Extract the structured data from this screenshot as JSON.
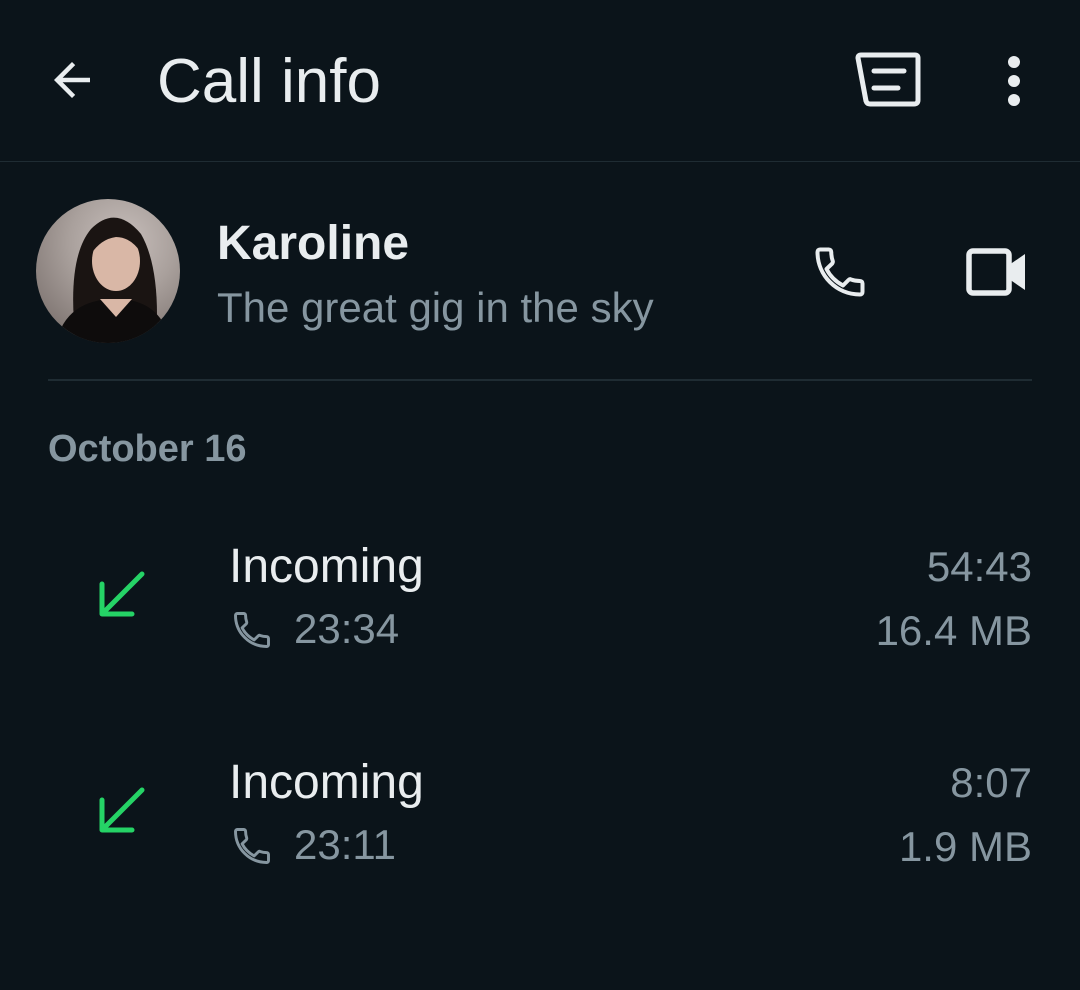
{
  "header": {
    "title": "Call info",
    "back_icon": "arrow-left-icon",
    "message_icon": "message-icon",
    "more_icon": "more-vertical-icon"
  },
  "contact": {
    "name": "Karoline",
    "status": "The great gig in the sky",
    "call_icon": "phone-icon",
    "video_icon": "video-icon"
  },
  "log": {
    "date": "October 16",
    "calls": [
      {
        "direction": "Incoming",
        "time": "23:34",
        "duration": "54:43",
        "size": "16.4 MB"
      },
      {
        "direction": "Incoming",
        "time": "23:11",
        "duration": "8:07",
        "size": "1.9 MB"
      }
    ]
  },
  "colors": {
    "background": "#0b141a",
    "incoming_arrow": "#25d366",
    "primary_text": "#e9edef",
    "secondary_text": "#8696a0"
  }
}
